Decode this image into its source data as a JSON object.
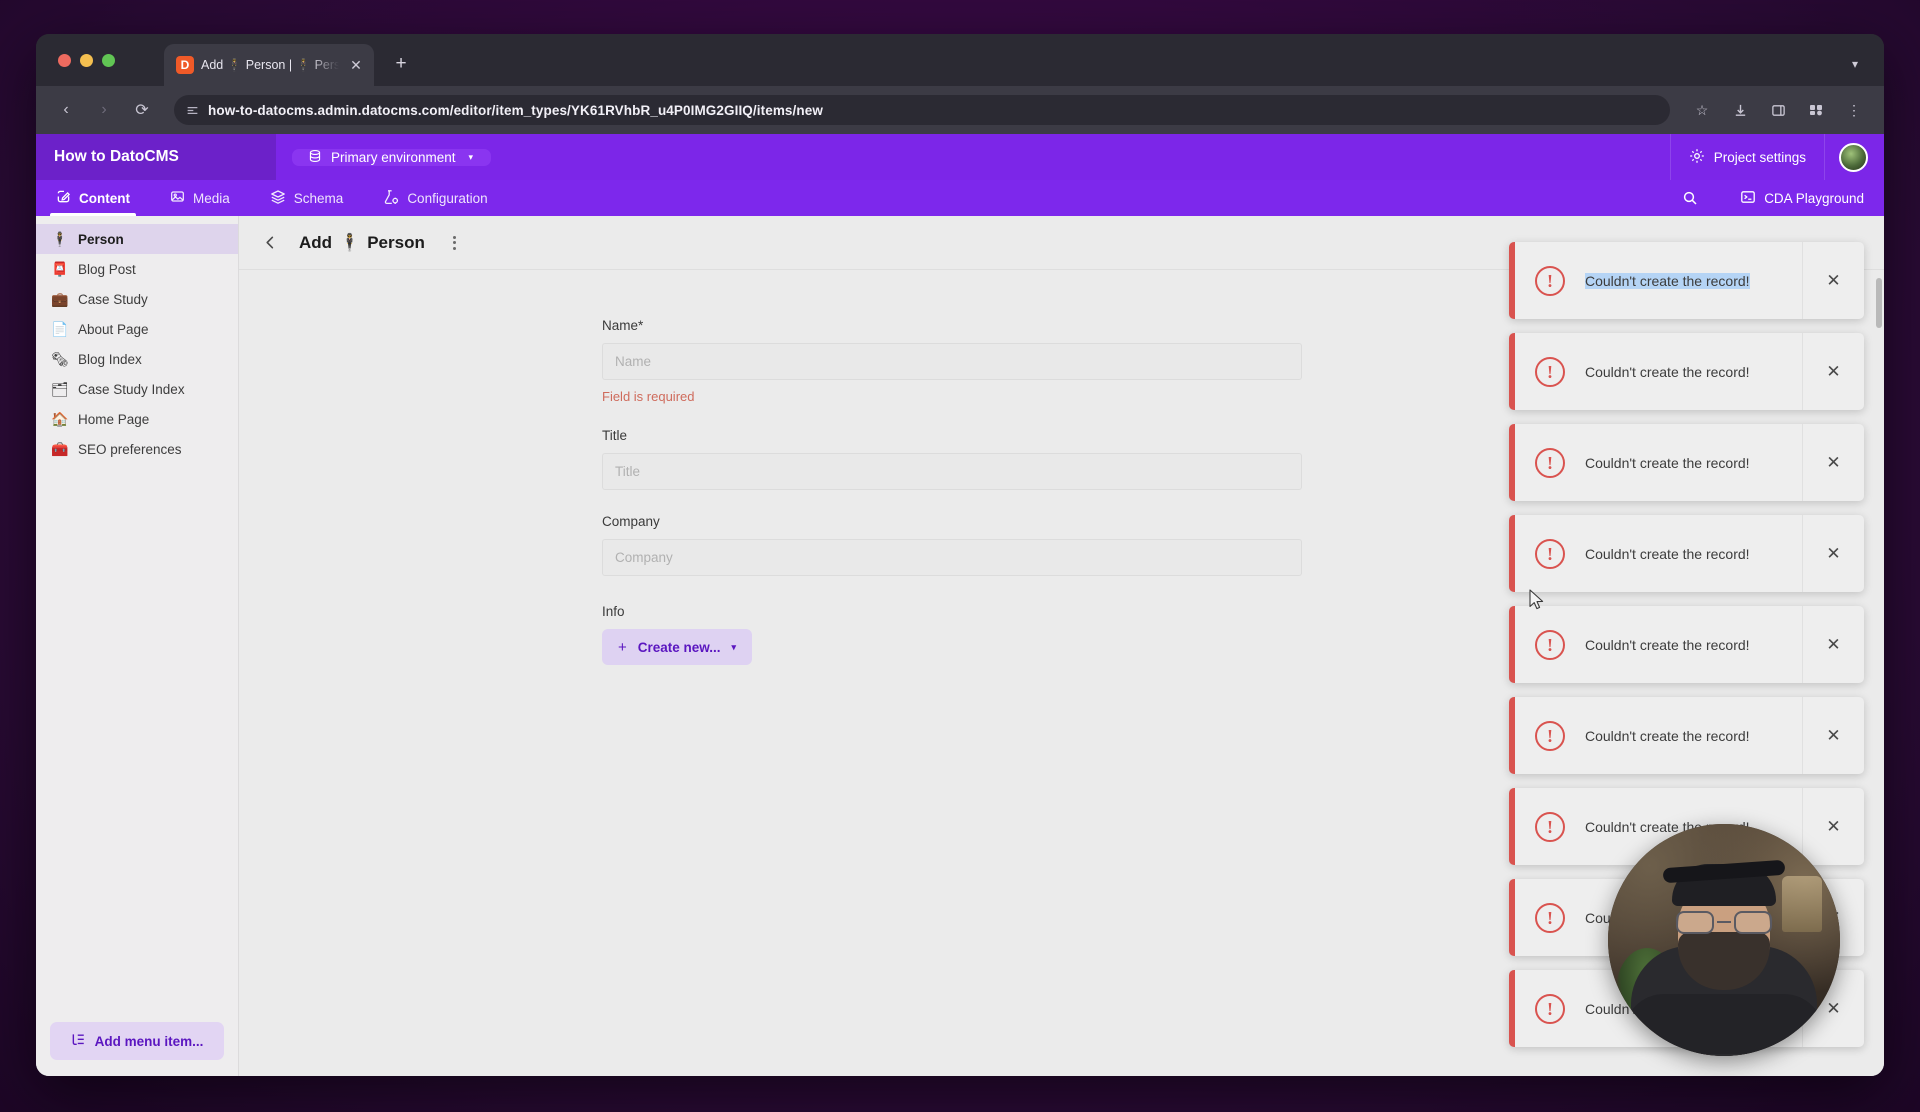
{
  "browser": {
    "tab": {
      "title": "Add 🕴 Person | 🕴 Person c…",
      "favicon_letter": "D",
      "close_icon": "close-icon"
    },
    "new_tab_label": "+",
    "tab_list_chevron": "▾",
    "nav": {
      "back": "‹",
      "forward": "›",
      "reload": "⟳"
    },
    "url": "how-to-datocms.admin.datocms.com/editor/item_types/YK61RVhbR_u4P0IMG2GIIQ/items/new",
    "omnibox_icon": "site-settings-icon",
    "actions": {
      "bookmark": "☆",
      "download": "download-icon",
      "sidepanel": "sidepanel-icon",
      "extensions": "extensions-icon",
      "menu": "⋮"
    }
  },
  "app": {
    "brand": "How to DatoCMS",
    "environment": "Primary environment",
    "environment_caret": "▾",
    "project_settings": "Project settings",
    "nav_items": [
      {
        "label": "Content",
        "icon": "content-pencil-icon",
        "active": true
      },
      {
        "label": "Media",
        "icon": "media-image-icon",
        "active": false
      },
      {
        "label": "Schema",
        "icon": "schema-layers-icon",
        "active": false
      },
      {
        "label": "Configuration",
        "icon": "configuration-flask-icon",
        "active": false
      }
    ],
    "search_icon": "search-icon",
    "cda_playground": "CDA Playground",
    "cda_icon": "terminal-icon"
  },
  "sidebar": {
    "items": [
      {
        "label": "Person",
        "emoji": "🕴",
        "active": true
      },
      {
        "label": "Blog Post",
        "emoji": "📮",
        "active": false
      },
      {
        "label": "Case Study",
        "emoji": "💼",
        "active": false
      },
      {
        "label": "About Page",
        "emoji": "📄",
        "active": false
      },
      {
        "label": "Blog Index",
        "emoji": "🗞",
        "active": false
      },
      {
        "label": "Case Study Index",
        "emoji": "🗂",
        "active": false
      },
      {
        "label": "Home Page",
        "emoji": "🏠",
        "active": false
      },
      {
        "label": "SEO preferences",
        "emoji": "🧰",
        "active": false
      }
    ],
    "add_menu_item": "Add menu item...",
    "add_menu_icon": "menu-list-icon"
  },
  "main": {
    "back_icon": "chevron-left-icon",
    "title_prefix": "Add",
    "title_emoji": "🕴",
    "title": "Person",
    "kebab_icon": "kebab-menu-icon",
    "fields": [
      {
        "label": "Name*",
        "placeholder": "Name",
        "value": "",
        "error": "Field is required",
        "type": "text"
      },
      {
        "label": "Title",
        "placeholder": "Title",
        "value": "",
        "error": "",
        "type": "text"
      },
      {
        "label": "Company",
        "placeholder": "Company",
        "value": "",
        "error": "",
        "type": "text"
      }
    ],
    "info_field": {
      "label": "Info",
      "button_label": "Create new...",
      "button_plus": "+",
      "button_caret": "▾"
    }
  },
  "toasts": {
    "message": "Couldn't create the record!",
    "close_icon": "close-icon",
    "warn_icon": "warning-circle-icon",
    "accent_color": "#d9534f",
    "selection_color": "#b5d4f5",
    "items": [
      {
        "selected": true
      },
      {
        "selected": false
      },
      {
        "selected": false
      },
      {
        "selected": false
      },
      {
        "selected": false
      },
      {
        "selected": false
      },
      {
        "selected": false
      },
      {
        "selected": false
      },
      {
        "selected": false
      }
    ]
  },
  "webcam": {
    "label": "presenter-webcam"
  }
}
